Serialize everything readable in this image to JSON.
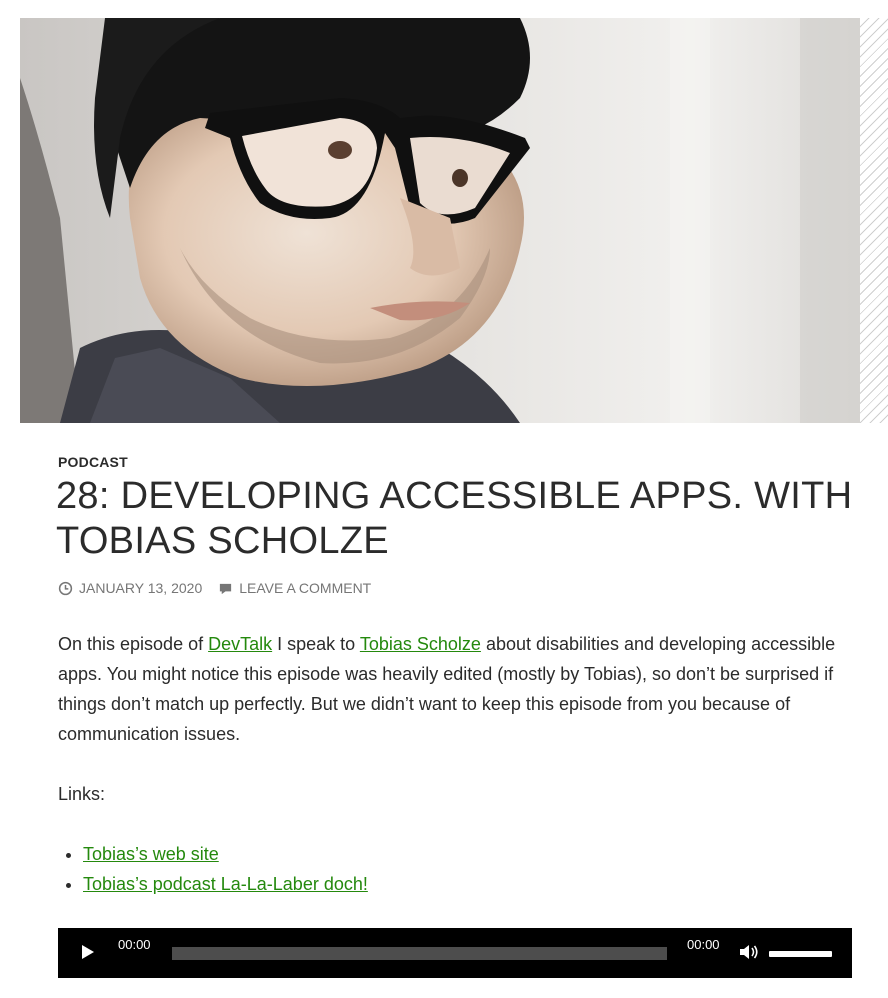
{
  "post": {
    "category": "PODCAST",
    "title": "28: Developing Accessible Apps. With Tobias Scholze",
    "date": "January 13, 2020",
    "comment_link": "Leave a comment"
  },
  "content": {
    "p1_before": "On this episode of ",
    "link_devtalk": "DevTalk",
    "p1_mid": " I speak to ",
    "link_tobias": "Tobias Scholze",
    "p1_after": " about disabilities and developing accessible apps. You might notice this episode was heavily edited (mostly by Tobias), so don’t be surprised if things don’t match up perfectly. But we didn’t want to keep this episode from you because of communication issues.",
    "links_heading": "Links:",
    "links": [
      {
        "label": "Tobias’s web site"
      },
      {
        "label": "Tobias’s podcast La-La-Laber doch!"
      }
    ]
  },
  "player": {
    "current_time": "00:00",
    "duration": "00:00",
    "progress": 0,
    "volume": 1.0,
    "icons": [
      "play-icon",
      "volume-icon"
    ]
  },
  "colors": {
    "link": "#24890d",
    "text": "#2b2b2b",
    "meta": "#767676",
    "player_bg": "#000000"
  }
}
